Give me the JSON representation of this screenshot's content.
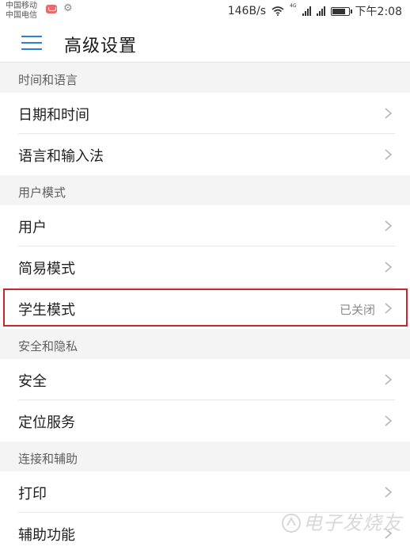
{
  "status_bar": {
    "carrier_1": "中国移动",
    "carrier_2": "中国电信",
    "net_speed": "146B/s",
    "net_type": "4G",
    "sig2_label": "3G\n2G",
    "time": "下午2:08",
    "battery_level": 0.85
  },
  "app_bar": {
    "title": "高级设置"
  },
  "sections": [
    {
      "label": "时间和语言",
      "items": [
        {
          "label": "日期和时间"
        },
        {
          "label": "语言和输入法"
        }
      ]
    },
    {
      "label": "用户模式",
      "items": [
        {
          "label": "用户"
        },
        {
          "label": "简易模式"
        },
        {
          "label": "学生模式",
          "value": "已关闭"
        }
      ]
    },
    {
      "label": "安全和隐私",
      "items": [
        {
          "label": "安全"
        },
        {
          "label": "定位服务"
        }
      ]
    },
    {
      "label": "连接和辅助",
      "items": [
        {
          "label": "打印"
        },
        {
          "label": "辅助功能"
        }
      ]
    }
  ],
  "watermark": "电子发烧友",
  "colors": {
    "accent": "#2f7fd6",
    "highlight": "#c9272d",
    "section_bg": "#f4f4f4"
  }
}
